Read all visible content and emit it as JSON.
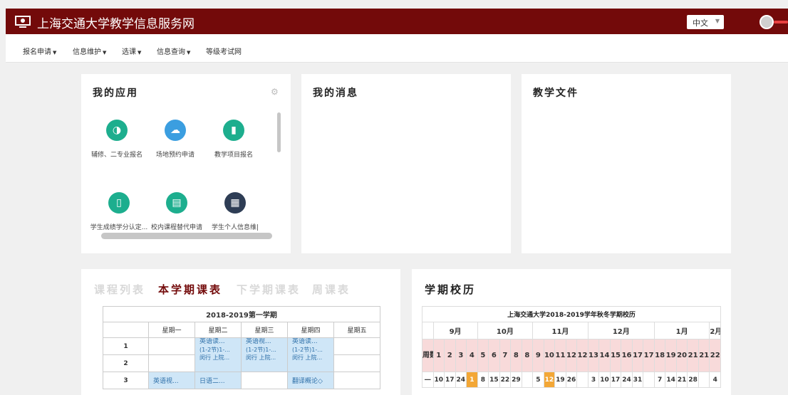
{
  "header": {
    "title": "上海交通大学教学信息服务网",
    "language": "中文",
    "brand_color": "#730a0a"
  },
  "nav": {
    "items": [
      {
        "label": "报名申请",
        "has_dropdown": true
      },
      {
        "label": "信息维护",
        "has_dropdown": true
      },
      {
        "label": "选课",
        "has_dropdown": true
      },
      {
        "label": "信息查询",
        "has_dropdown": true
      },
      {
        "label": "等级考试网",
        "has_dropdown": false
      }
    ]
  },
  "apps_panel": {
    "title": "我的应用",
    "apps": [
      {
        "label": "辅修、二专业报名",
        "icon": "pie-chart-icon",
        "color": "#1dae8e"
      },
      {
        "label": "场地预约申请",
        "icon": "chat-bubbles-icon",
        "color": "#3b9ee0"
      },
      {
        "label": "教学项目报名",
        "icon": "book-icon",
        "color": "#1dae8e"
      },
      {
        "label": "学生成绩学分认定...",
        "icon": "open-book-icon",
        "color": "#1dae8e"
      },
      {
        "label": "校内课程替代申请",
        "icon": "document-icon",
        "color": "#1dae8e"
      },
      {
        "label": "学生个人信息维|",
        "icon": "calendar-list-icon",
        "color": "#2e3d55"
      }
    ]
  },
  "messages_panel": {
    "title": "我的消息"
  },
  "docs_panel": {
    "title": "教学文件"
  },
  "schedule_panel": {
    "tabs": [
      {
        "label": "课程列表",
        "active": false
      },
      {
        "label": "本学期课表",
        "active": true
      },
      {
        "label": "下学期课表",
        "active": false
      },
      {
        "label": "周课表",
        "active": false
      }
    ],
    "caption": "2018-2019第一学期",
    "days": [
      "星期一",
      "星期二",
      "星期三",
      "星期四",
      "星期五"
    ],
    "periods": [
      "1",
      "2",
      "3"
    ],
    "courses": {
      "tue_1": {
        "name": "英语读...",
        "l2": "(1-2节)1-...",
        "l3": "闵行 上院..."
      },
      "wed_1": {
        "name": "英语视...",
        "l2": "(1-2节)1-...",
        "l3": "闵行 上院..."
      },
      "thu_1": {
        "name": "英语读...",
        "l2": "(1-2节)1-...",
        "l3": "闵行 上院..."
      },
      "mon_3": {
        "name": "英语视..."
      },
      "tue_3": {
        "name": "日语二..."
      },
      "thu_3": {
        "name": "翻译概论◇"
      }
    }
  },
  "calendar_panel": {
    "title": "学期校历",
    "caption": "上海交通大学2018-2019学年秋冬学期校历",
    "months": [
      "9月",
      "10月",
      "11月",
      "12月",
      "1月",
      "2月"
    ],
    "week_label": "周数",
    "weeks": [
      "1",
      "2",
      "3",
      "4",
      "5",
      "6",
      "7",
      "8",
      "8",
      "9",
      "10",
      "11",
      "12",
      "12",
      "13",
      "14",
      "15",
      "16",
      "17",
      "17",
      "18",
      "19",
      "20",
      "21",
      "21",
      "22"
    ],
    "row_label": "一",
    "days": [
      "10",
      "17",
      "24",
      "1",
      "8",
      "15",
      "22",
      "29",
      "",
      "5",
      "12",
      "19",
      "26",
      "",
      "3",
      "10",
      "17",
      "24",
      "31",
      "",
      "7",
      "14",
      "21",
      "28",
      "",
      "4"
    ],
    "highlight_color": "#f3a736",
    "highlights": [
      3,
      10
    ]
  }
}
